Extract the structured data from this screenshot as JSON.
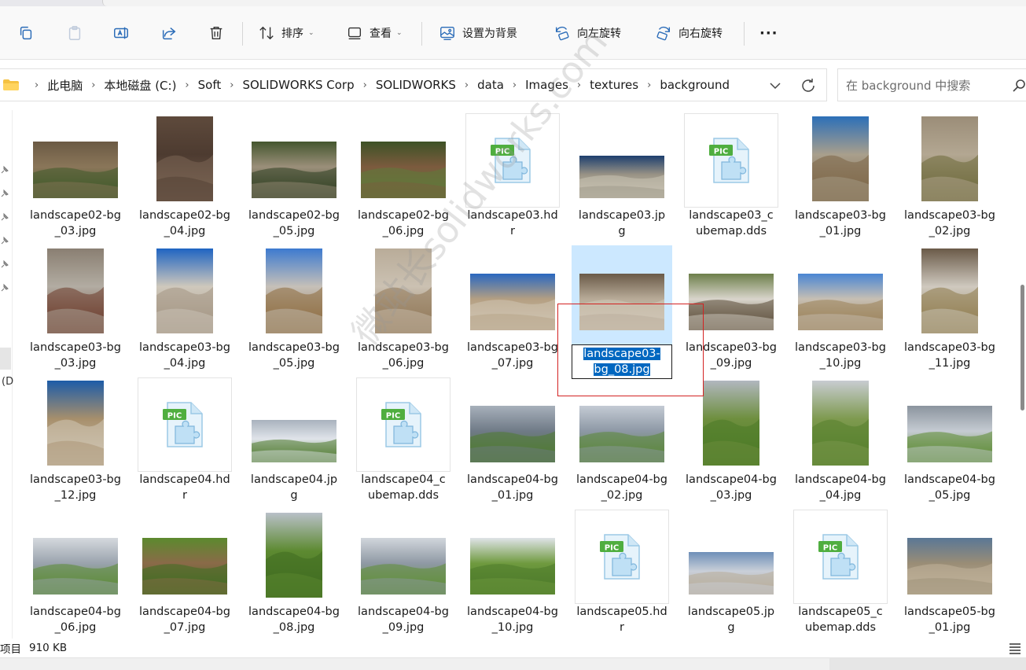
{
  "toolbar": {
    "sort_label": "排序",
    "view_label": "查看",
    "set_background_label": "设置为背景",
    "rotate_left_label": "向左旋转",
    "rotate_right_label": "向右旋转",
    "more_label": "···"
  },
  "address": {
    "crumbs": [
      "此电脑",
      "本地磁盘 (C:)",
      "Soft",
      "SOLIDWORKS Corp",
      "SOLIDWORKS",
      "data",
      "Images",
      "textures",
      "background"
    ]
  },
  "search": {
    "placeholder": "在 background 中搜索"
  },
  "nav": {
    "partial_label": "(D"
  },
  "files": [
    {
      "name": "landscape02-bg_03.jpg",
      "thumb": "photo-wide",
      "colors": [
        "#6b5a44",
        "#8a7659",
        "#3f5a2a"
      ]
    },
    {
      "name": "landscape02-bg_04.jpg",
      "thumb": "photo-tall",
      "colors": [
        "#5e4a3c",
        "#4d3b30",
        "#7a6553"
      ]
    },
    {
      "name": "landscape02-bg_05.jpg",
      "thumb": "photo-wide",
      "colors": [
        "#44562e",
        "#9b8f7a",
        "#2f3f22"
      ]
    },
    {
      "name": "landscape02-bg_06.jpg",
      "thumb": "photo-wide",
      "colors": [
        "#3d5226",
        "#7c5b3e",
        "#5f7a3a"
      ]
    },
    {
      "name": "landscape03.hdr",
      "thumb": "pic-icon"
    },
    {
      "name": "landscape03.jpg",
      "thumb": "photo-pano",
      "colors": [
        "#1d3f6e",
        "#9a9486",
        "#c9c3b3"
      ]
    },
    {
      "name": "landscape03_cubemap.dds",
      "thumb": "pic-icon"
    },
    {
      "name": "landscape03-bg_01.jpg",
      "thumb": "photo-tall",
      "colors": [
        "#2c6fb8",
        "#a99f8c",
        "#7c6545"
      ]
    },
    {
      "name": "landscape03-bg_02.jpg",
      "thumb": "photo-tall",
      "colors": [
        "#9b8d78",
        "#b3a792",
        "#6d6a3a"
      ]
    },
    {
      "name": "landscape03-bg_03.jpg",
      "thumb": "photo-tall",
      "colors": [
        "#8a7f72",
        "#b2aca2",
        "#6b3a2a"
      ]
    },
    {
      "name": "landscape03-bg_04.jpg",
      "thumb": "photo-tall",
      "colors": [
        "#1f64c2",
        "#cfc8bc",
        "#a49684"
      ]
    },
    {
      "name": "landscape03-bg_05.jpg",
      "thumb": "photo-tall",
      "colors": [
        "#3d7ad0",
        "#c6c0b8",
        "#8c6a3c"
      ]
    },
    {
      "name": "landscape03-bg_06.jpg",
      "thumb": "photo-tall",
      "colors": [
        "#b9ac99",
        "#cbc1b2",
        "#8f7656"
      ]
    },
    {
      "name": "landscape03-bg_07.jpg",
      "thumb": "photo-wide",
      "colors": [
        "#2a68c0",
        "#b49f82",
        "#cfc4b2"
      ]
    },
    {
      "name": "landscape03-bg_08.jpg",
      "thumb": "photo-wide",
      "colors": [
        "#6a5a48",
        "#b8ab98",
        "#d2c8b8"
      ],
      "selected": true
    },
    {
      "name": "landscape03-bg_09.jpg",
      "thumb": "photo-wide",
      "colors": [
        "#6d7f4a",
        "#d9d5cc",
        "#5a4a36"
      ]
    },
    {
      "name": "landscape03-bg_10.jpg",
      "thumb": "photo-wide",
      "colors": [
        "#4a86d4",
        "#c7bfb3",
        "#9a8158"
      ]
    },
    {
      "name": "landscape03-bg_11.jpg",
      "thumb": "photo-tall",
      "colors": [
        "#6a5a48",
        "#cfc9bf",
        "#8e7a4a"
      ]
    },
    {
      "name": "landscape03-bg_12.jpg",
      "thumb": "photo-tall",
      "colors": [
        "#1d5ca8",
        "#a78f6c",
        "#d0c6b4"
      ]
    },
    {
      "name": "landscape04.hdr",
      "thumb": "pic-icon"
    },
    {
      "name": "landscape04.jpg",
      "thumb": "photo-pano",
      "colors": [
        "#a9b2bd",
        "#e0e4ea",
        "#4f7a2e"
      ]
    },
    {
      "name": "landscape04_cubemap.dds",
      "thumb": "pic-icon"
    },
    {
      "name": "landscape04-bg_01.jpg",
      "thumb": "photo-wide",
      "colors": [
        "#a7b0bb",
        "#6f7a86",
        "#4e7a30"
      ]
    },
    {
      "name": "landscape04-bg_02.jpg",
      "thumb": "photo-wide",
      "colors": [
        "#c4cbd4",
        "#8d98a5",
        "#5a8636"
      ]
    },
    {
      "name": "landscape04-bg_03.jpg",
      "thumb": "photo-tall",
      "colors": [
        "#b1b7bf",
        "#6e8f3e",
        "#4b7a26"
      ]
    },
    {
      "name": "landscape04-bg_04.jpg",
      "thumb": "photo-tall",
      "colors": [
        "#c8ccd1",
        "#7e9a4f",
        "#55802c"
      ]
    },
    {
      "name": "landscape04-bg_05.jpg",
      "thumb": "photo-wide",
      "colors": [
        "#8b949e",
        "#c5cbd2",
        "#5b8a30"
      ]
    },
    {
      "name": "landscape04-bg_06.jpg",
      "thumb": "photo-wide",
      "colors": [
        "#d5d9de",
        "#9aa3ad",
        "#5a8a32"
      ]
    },
    {
      "name": "landscape04-bg_07.jpg",
      "thumb": "photo-wide",
      "colors": [
        "#5c8a2e",
        "#8a6a48",
        "#3f6d22"
      ]
    },
    {
      "name": "landscape04-bg_08.jpg",
      "thumb": "photo-tall",
      "colors": [
        "#b9c0c8",
        "#5d8a31",
        "#3f6b20"
      ]
    },
    {
      "name": "landscape04-bg_09.jpg",
      "thumb": "photo-wide",
      "colors": [
        "#d1d6dc",
        "#8f99a4",
        "#5f8e35"
      ]
    },
    {
      "name": "landscape04-bg_10.jpg",
      "thumb": "photo-wide",
      "colors": [
        "#dfe3e8",
        "#6f9a3f",
        "#4c7a2a"
      ]
    },
    {
      "name": "landscape05.hdr",
      "thumb": "pic-icon"
    },
    {
      "name": "landscape05.jpg",
      "thumb": "photo-pano",
      "colors": [
        "#6e8fb8",
        "#c9cfd8",
        "#b8ad9a"
      ]
    },
    {
      "name": "landscape05_cubemap.dds",
      "thumb": "pic-icon"
    },
    {
      "name": "landscape05-bg_01.jpg",
      "thumb": "photo-wide",
      "colors": [
        "#5a7796",
        "#9a8d76",
        "#c1b39a"
      ]
    }
  ],
  "status": {
    "items_label": "项目",
    "size_label": "910 KB"
  },
  "watermark": {
    "text": "微站长solidworks.com"
  },
  "colors": {
    "accent": "#0067c0",
    "selection": "#cce8ff",
    "annotation": "#d32222"
  }
}
